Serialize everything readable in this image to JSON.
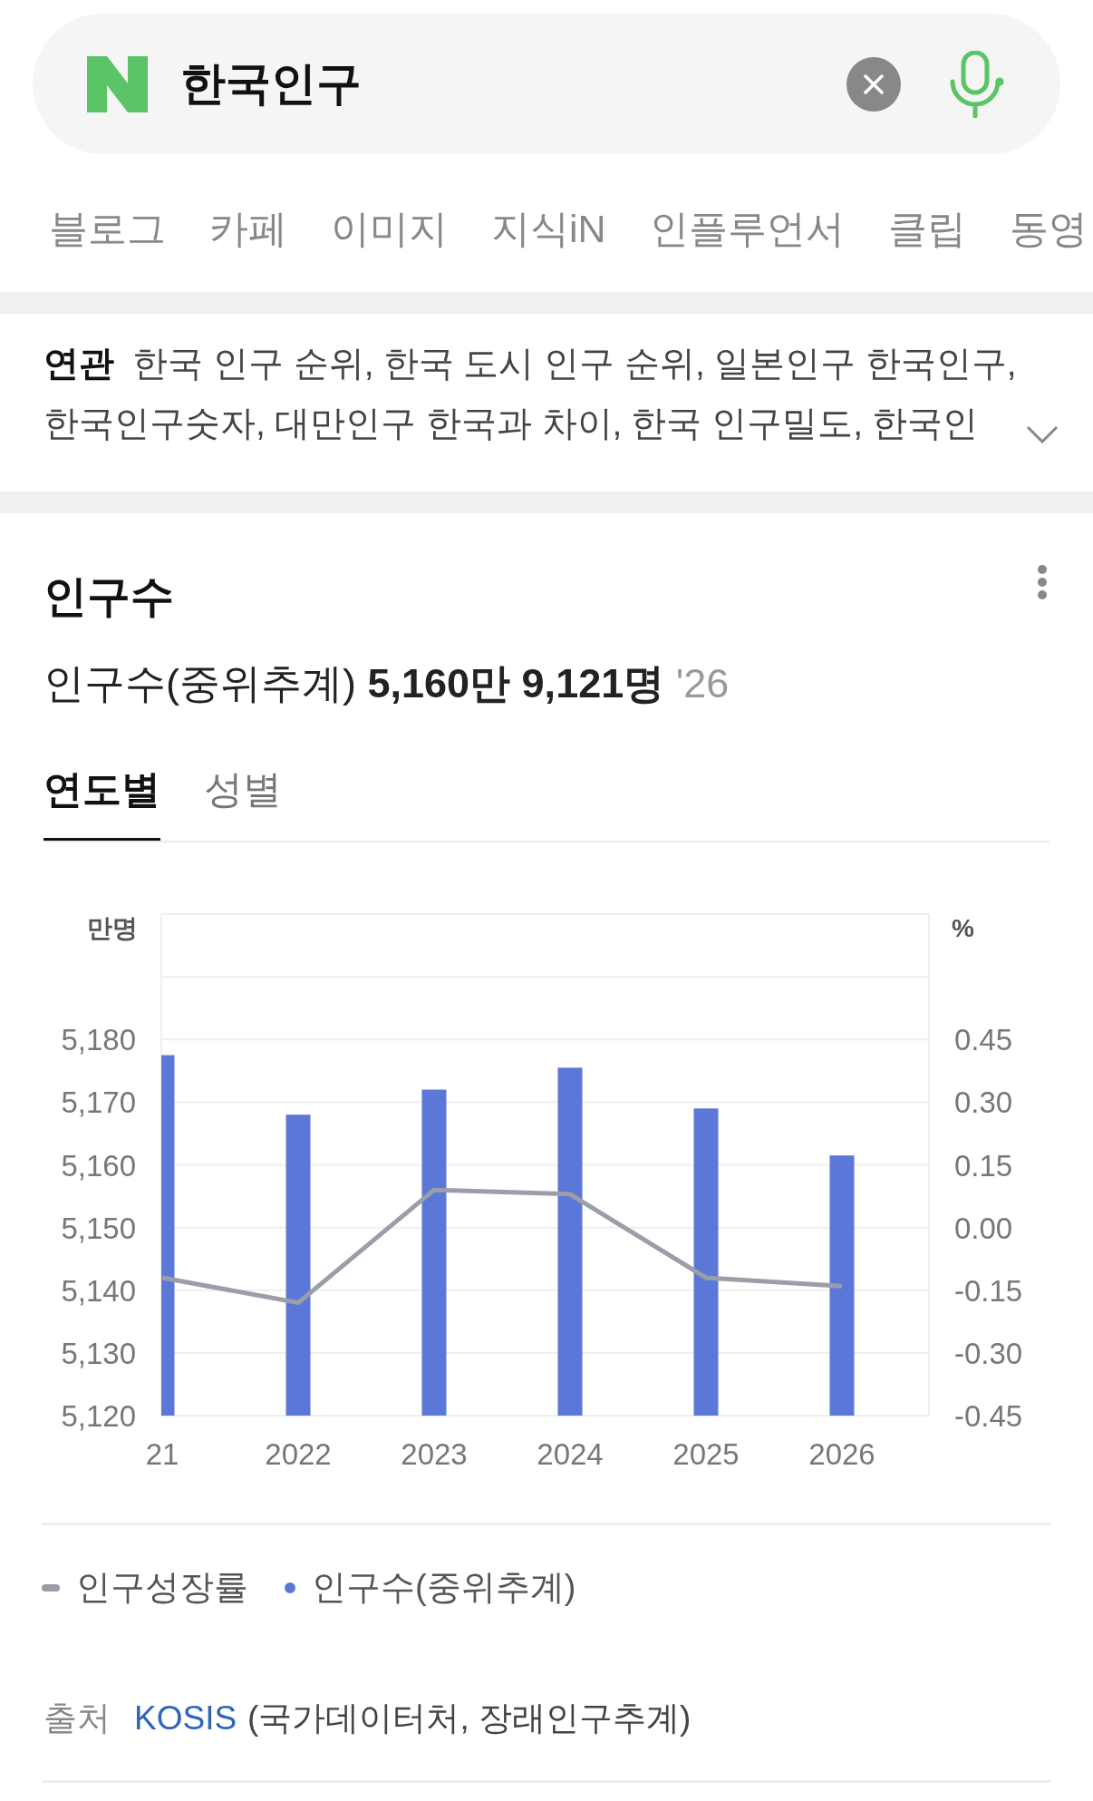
{
  "search": {
    "query": "한국인구"
  },
  "tabs": [
    {
      "label": "블로그"
    },
    {
      "label": "카페"
    },
    {
      "label": "이미지"
    },
    {
      "label": "지식iN"
    },
    {
      "label": "인플루언서"
    },
    {
      "label": "클립"
    },
    {
      "label": "동영"
    }
  ],
  "related": {
    "label": "연관",
    "lines": [
      [
        "한국 인구 순위,",
        "한국 도시 인구 순위,",
        "일본인구 한국인구,"
      ],
      [
        "한국인구숫자,",
        "대만인구 한국과 차이,",
        "한국 인구밀도,",
        "한국인"
      ]
    ]
  },
  "card": {
    "title": "인구수",
    "summary_label": "인구수(중위추계)",
    "summary_value": "5,160만 9,121명",
    "summary_year": "'26",
    "tabs": [
      {
        "label": "연도별",
        "selected": true
      },
      {
        "label": "성별",
        "selected": false
      }
    ],
    "chart_data": {
      "type": "bar",
      "ylabel": "만명",
      "grid": true,
      "categories": [
        "21",
        "2022",
        "2023",
        "2024",
        "2025",
        "2026"
      ],
      "ylim": [
        5120,
        5200
      ],
      "yticks": [
        {
          "value": 5120,
          "label": "5,120"
        },
        {
          "value": 5130,
          "label": "5,130"
        },
        {
          "value": 5140,
          "label": "5,140"
        },
        {
          "value": 5150,
          "label": "5,150"
        },
        {
          "value": 5160,
          "label": "5,160"
        },
        {
          "value": 5170,
          "label": "5,170"
        },
        {
          "value": 5180,
          "label": "5,180"
        }
      ],
      "series": [
        {
          "name": "인구수(중위추계)",
          "color": "#5b78d8",
          "values": [
            5177.5,
            5168,
            5172,
            5175.5,
            5169,
            5161.5
          ]
        }
      ]
    },
    "rate_chart": {
      "chart_data": {
        "type": "line",
        "ylabel": "%",
        "ylim": [
          -0.45,
          0.75
        ],
        "yticks": [
          {
            "value": -0.45,
            "label": "-0.45"
          },
          {
            "value": -0.3,
            "label": "-0.30"
          },
          {
            "value": -0.15,
            "label": "-0.15"
          },
          {
            "value": 0,
            "label": "0.00"
          },
          {
            "value": 0.15,
            "label": "0.15"
          },
          {
            "value": 0.3,
            "label": "0.30"
          },
          {
            "value": 0.45,
            "label": "0.45"
          }
        ],
        "series": [
          {
            "name": "인구성장률",
            "color": "#9a9ea8",
            "values": [
              -0.12,
              -0.18,
              0.09,
              0.08,
              -0.12,
              -0.14
            ]
          }
        ]
      }
    },
    "source": {
      "label": "출처",
      "link": "KOSIS",
      "detail": "(국가데이터처, 장래인구추계)"
    }
  }
}
